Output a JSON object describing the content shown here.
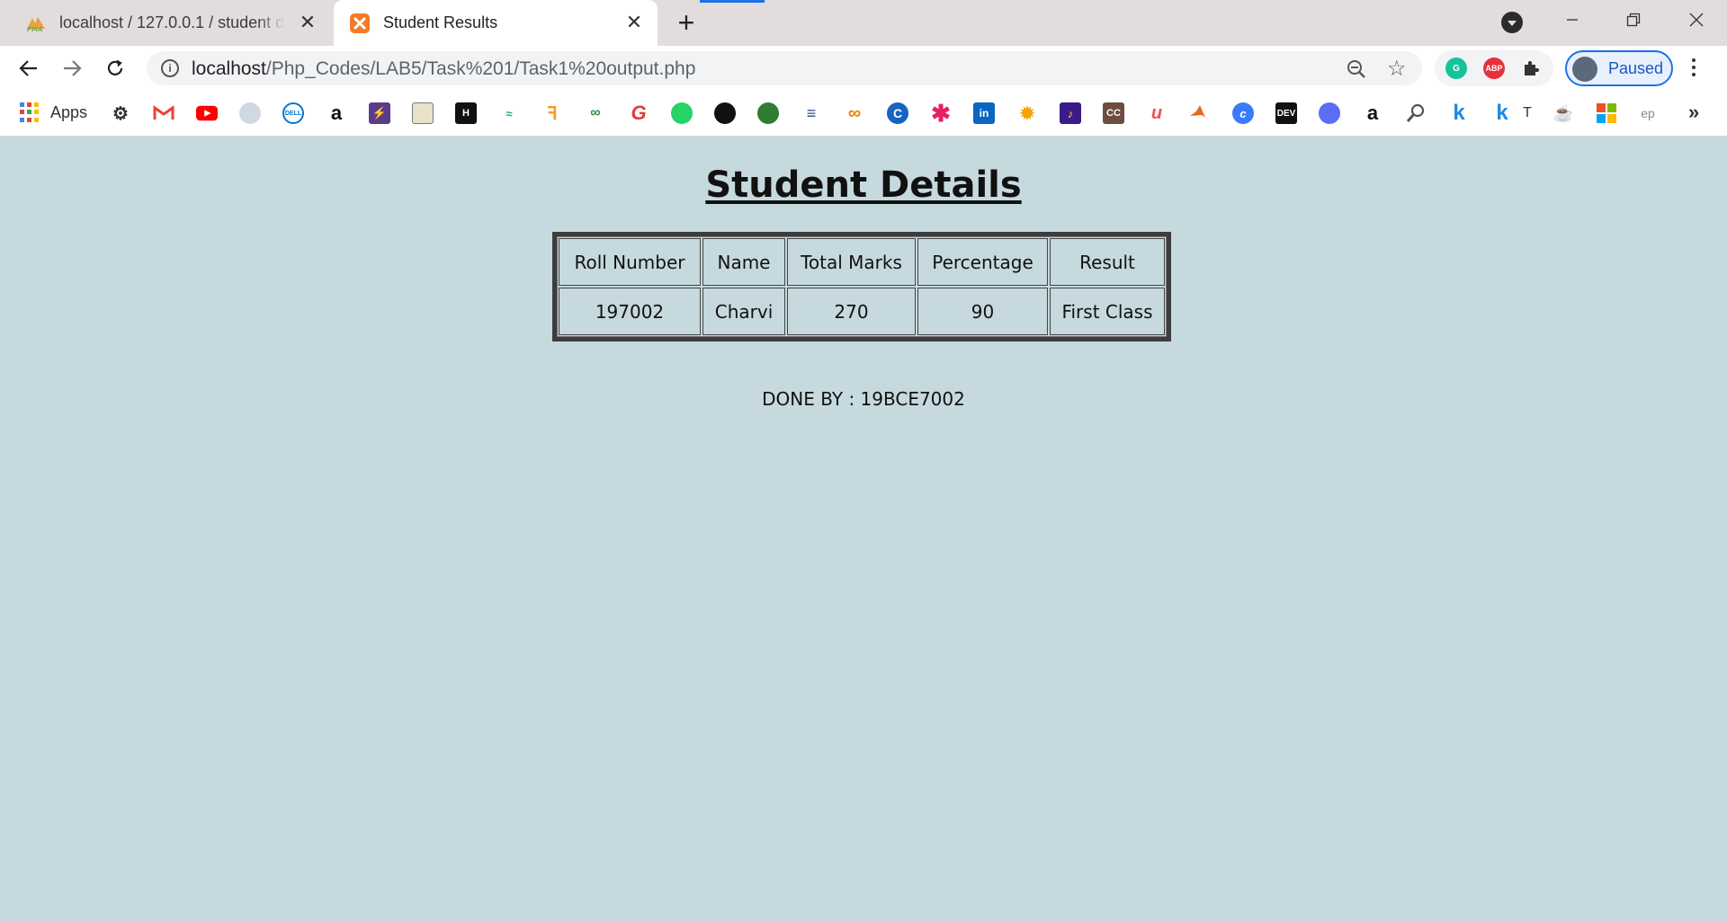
{
  "browser": {
    "tabs": [
      {
        "title": "localhost / 127.0.0.1 / student de",
        "favicon": "phpmyadmin-icon",
        "close": "✕"
      },
      {
        "title": "Student Results",
        "favicon": "xampp-icon",
        "close": "✕"
      }
    ],
    "new_tab": "+",
    "url_host": "localhost",
    "url_path": "/Php_Codes/LAB5/Task%201/Task1%20output.php",
    "profile_label": "Paused",
    "apps_label": "Apps",
    "bookmarks": [
      "settings-icon",
      "gmail-icon",
      "youtube-icon",
      "bookmark-icon",
      "dell-icon",
      "amazon-icon",
      "bolt-icon",
      "image-icon",
      "hackerrank-icon",
      "chart-icon",
      "leetcode-icon",
      "geeksforgeeks-icon",
      "google-icon",
      "whatsapp-icon",
      "github-icon",
      "circle-icon",
      "stack-icon",
      "infinity-icon",
      "c-icon",
      "asterisk-icon",
      "linkedin-icon",
      "sun-icon",
      "music-icon",
      "cc-icon",
      "udemy-icon",
      "matlab-icon",
      "coursera-icon",
      "dev-icon",
      "meet-icon",
      "amazon-icon",
      "search-icon",
      "k-icon",
      "k-icon",
      "t-icon",
      "java-icon",
      "microsoft-icon",
      "ep-icon"
    ],
    "dev_label": "DEV",
    "cc_label": "CC",
    "k_label": "k",
    "t_label": "T",
    "ep_label": "ep",
    "abp_label": "ABP",
    "amazon_label": "a",
    "colors": {
      "tab_strip": "#e3dcdc",
      "page_bg": "#c5d9de",
      "accent": "#1a73e8"
    }
  },
  "page": {
    "heading": "Student Details",
    "table": {
      "headers": [
        "Roll Number",
        "Name",
        "Total Marks",
        "Percentage",
        "Result"
      ],
      "rows": [
        [
          "197002",
          "Charvi",
          "270",
          "90",
          "First Class"
        ]
      ]
    },
    "done_by": "DONE BY : 19BCE7002"
  }
}
